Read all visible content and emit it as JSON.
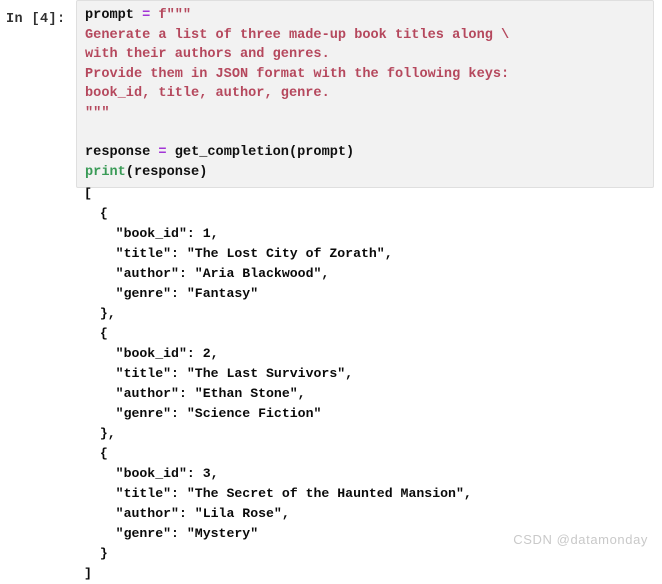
{
  "notebook": {
    "input_prompt": "In [4]:",
    "output_prompt": "",
    "watermark": "CSDN @datamonday",
    "colors": {
      "cell_background": "#f2f2f2",
      "cell_border": "#dfdfdf",
      "string": "#b5485d",
      "operator": "#a235d6",
      "builtin_function": "#3a9b57",
      "plain_code": "#101010",
      "output_text": "#0a0a0a",
      "watermark": "#c9c9c9",
      "page_background": "#ffffff"
    }
  },
  "code_cell": {
    "language": "python",
    "lines": [
      {
        "tokens": [
          {
            "text": "prompt ",
            "type": "plain"
          },
          {
            "text": "=",
            "type": "operator"
          },
          {
            "text": " ",
            "type": "plain"
          },
          {
            "text": "f\"\"\"",
            "type": "string"
          }
        ]
      },
      {
        "tokens": [
          {
            "text": "Generate a list of three made-up book titles along \\",
            "type": "string"
          }
        ]
      },
      {
        "tokens": [
          {
            "text": "with their authors and genres.",
            "type": "string"
          }
        ]
      },
      {
        "tokens": [
          {
            "text": "Provide them in JSON format with the following keys:",
            "type": "string"
          }
        ]
      },
      {
        "tokens": [
          {
            "text": "book_id, title, author, genre.",
            "type": "string"
          }
        ]
      },
      {
        "tokens": [
          {
            "text": "\"\"\"",
            "type": "string"
          }
        ]
      },
      {
        "tokens": [
          {
            "text": "",
            "type": "plain"
          }
        ]
      },
      {
        "tokens": [
          {
            "text": "response ",
            "type": "plain"
          },
          {
            "text": "=",
            "type": "operator"
          },
          {
            "text": " get_completion(prompt)",
            "type": "plain"
          }
        ]
      },
      {
        "tokens": [
          {
            "text": "print",
            "type": "builtin"
          },
          {
            "text": "(response)",
            "type": "plain"
          }
        ]
      }
    ],
    "plain_source": "prompt = f\"\"\"\nGenerate a list of three made-up book titles along \\\nwith their authors and genres.\nProvide them in JSON format with the following keys:\nbook_id, title, author, genre.\n\"\"\"\n\nresponse = get_completion(prompt)\nprint(response)"
  },
  "output_cell": {
    "type": "stdout",
    "text": "[\n  {\n    \"book_id\": 1,\n    \"title\": \"The Lost City of Zorath\",\n    \"author\": \"Aria Blackwood\",\n    \"genre\": \"Fantasy\"\n  },\n  {\n    \"book_id\": 2,\n    \"title\": \"The Last Survivors\",\n    \"author\": \"Ethan Stone\",\n    \"genre\": \"Science Fiction\"\n  },\n  {\n    \"book_id\": 3,\n    \"title\": \"The Secret of the Haunted Mansion\",\n    \"author\": \"Lila Rose\",\n    \"genre\": \"Mystery\"\n  }\n]",
    "books": [
      {
        "book_id": 1,
        "title": "The Lost City of Zorath",
        "author": "Aria Blackwood",
        "genre": "Fantasy"
      },
      {
        "book_id": 2,
        "title": "The Last Survivors",
        "author": "Ethan Stone",
        "genre": "Science Fiction"
      },
      {
        "book_id": 3,
        "title": "The Secret of the Haunted Mansion",
        "author": "Lila Rose",
        "genre": "Mystery"
      }
    ]
  }
}
